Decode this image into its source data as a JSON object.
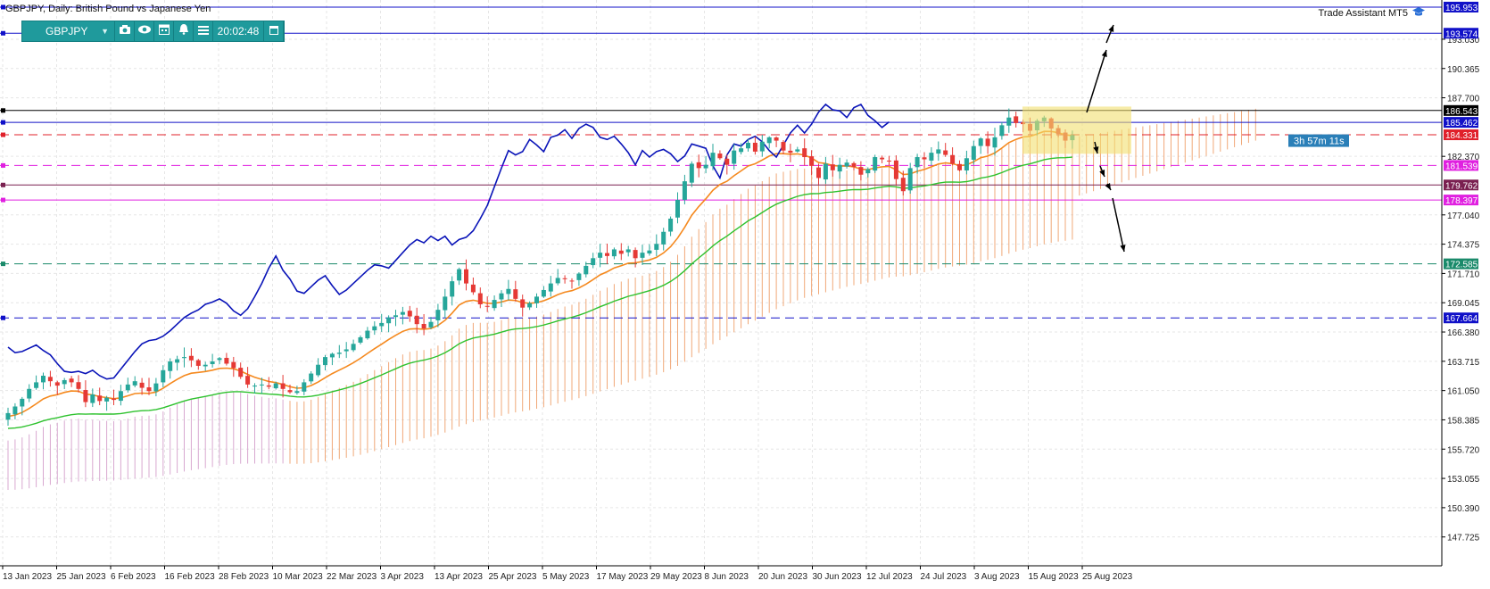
{
  "header": {
    "title": "GBPJPY, Daily:  British Pound vs Japanese Yen"
  },
  "toolbar": {
    "symbol": "GBPJPY",
    "time": "20:02:48",
    "icons": [
      "camera-icon",
      "eye-icon",
      "calendar-icon",
      "alarm-icon",
      "menu-icon",
      "window-icon"
    ]
  },
  "assistant": {
    "label": "Trade Assistant MT5",
    "icon": "graduation-cap-icon"
  },
  "timer": "3h 57m 11s",
  "chart_data": {
    "type": "candlestick",
    "symbol": "GBPJPY",
    "timeframe": "Daily",
    "ylim": [
      145.1,
      196.6
    ],
    "price_axis_ticks": [
      "193.030",
      "190.365",
      "187.700",
      "182.370",
      "177.040",
      "174.375",
      "171.710",
      "169.045",
      "166.380",
      "163.715",
      "161.050",
      "158.385",
      "155.720",
      "153.055",
      "150.390",
      "147.725"
    ],
    "date_axis_ticks": [
      "13 Jan 2023",
      "25 Jan 2023",
      "6 Feb 2023",
      "16 Feb 2023",
      "28 Feb 2023",
      "10 Mar 2023",
      "22 Mar 2023",
      "3 Apr 2023",
      "13 Apr 2023",
      "25 Apr 2023",
      "5 May 2023",
      "17 May 2023",
      "29 May 2023",
      "8 Jun 2023",
      "20 Jun 2023",
      "30 Jun 2023",
      "12 Jul 2023",
      "24 Jul 2023",
      "3 Aug 2023",
      "15 Aug 2023",
      "25 Aug 2023"
    ],
    "price_levels": [
      {
        "label": "195.953",
        "value": 195.953,
        "color": "#1010c8",
        "style": "solid"
      },
      {
        "label": "193.574",
        "value": 193.574,
        "color": "#1010c8",
        "style": "solid"
      },
      {
        "label": "186.543",
        "value": 186.543,
        "color": "#000000",
        "style": "solid"
      },
      {
        "label": "185.462",
        "value": 185.462,
        "color": "#1010c8",
        "style": "solid"
      },
      {
        "label": "184.331",
        "value": 184.331,
        "color": "#e0202a",
        "style": "dashed"
      },
      {
        "label": "181.539",
        "value": 181.539,
        "color": "#e020e0",
        "style": "dashed"
      },
      {
        "label": "179.762",
        "value": 179.762,
        "color": "#7a2050",
        "style": "solid"
      },
      {
        "label": "178.397",
        "value": 178.397,
        "color": "#e020e0",
        "style": "solid"
      },
      {
        "label": "172.585",
        "value": 172.585,
        "color": "#1a8a6a",
        "style": "dashed"
      },
      {
        "label": "167.664",
        "value": 167.664,
        "color": "#1010c8",
        "style": "dashed"
      }
    ],
    "close_series": [
      159.0,
      159.6,
      160.3,
      161.2,
      161.8,
      162.4,
      161.9,
      161.5,
      162.0,
      161.8,
      161.2,
      160.0,
      160.7,
      160.1,
      160.4,
      160.2,
      161.0,
      161.6,
      161.9,
      161.3,
      161.0,
      161.7,
      162.9,
      163.7,
      163.9,
      164.1,
      163.8,
      163.3,
      163.4,
      163.7,
      164.0,
      163.5,
      163.1,
      162.3,
      161.6,
      161.5,
      161.6,
      161.4,
      161.7,
      161.2,
      160.9,
      161.0,
      161.8,
      162.6,
      163.4,
      164.1,
      164.4,
      164.5,
      164.8,
      165.3,
      165.9,
      166.5,
      166.9,
      167.2,
      167.7,
      167.9,
      168.2,
      167.8,
      167.1,
      166.7,
      167.3,
      168.4,
      169.6,
      171.0,
      172.1,
      170.8,
      170.0,
      168.9,
      168.7,
      169.3,
      169.9,
      170.3,
      169.4,
      168.6,
      169.0,
      169.6,
      170.2,
      170.8,
      171.3,
      171.2,
      171.0,
      171.7,
      172.4,
      173.1,
      173.6,
      173.3,
      173.9,
      173.5,
      173.9,
      173.1,
      173.6,
      173.8,
      174.4,
      175.5,
      176.7,
      178.4,
      180.1,
      181.7,
      181.3,
      181.6,
      182.7,
      182.2,
      181.6,
      182.9,
      183.1,
      183.6,
      182.8,
      183.7,
      184.1,
      183.8,
      182.9,
      182.7,
      183.0,
      182.3,
      181.5,
      180.4,
      181.7,
      181.1,
      181.6,
      181.8,
      181.4,
      180.7,
      181.2,
      182.3,
      182.1,
      181.9,
      180.3,
      179.2,
      181.3,
      182.3,
      182.1,
      182.7,
      183.0,
      182.5,
      181.7,
      181.1,
      182.2,
      183.3,
      184.0,
      183.3,
      184.1,
      185.2,
      185.9,
      185.4,
      185.3,
      184.7,
      185.6,
      185.9,
      184.9,
      184.4,
      183.8,
      184.3
    ]
  }
}
